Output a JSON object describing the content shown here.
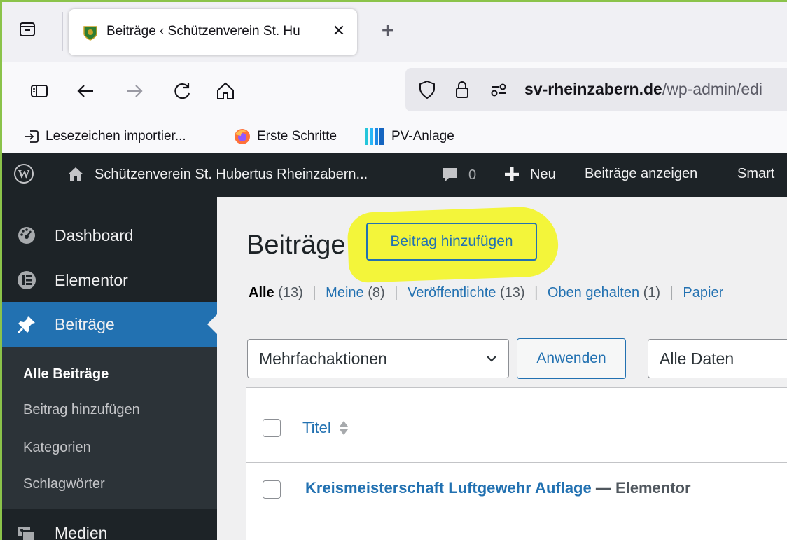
{
  "browser": {
    "tab": {
      "title": "Beiträge ‹ Schützenverein St. Hu",
      "close": "✕"
    },
    "new_tab": "+",
    "url": {
      "domain": "sv-rheinzabern.de",
      "path": "/wp-admin/edi"
    },
    "bookmarks": [
      {
        "label": "Lesezeichen importier..."
      },
      {
        "label": "Erste Schritte"
      },
      {
        "label": "PV-Anlage"
      }
    ]
  },
  "adminbar": {
    "site_name": "Schützenverein St. Hubertus Rheinzabern...",
    "comments_count": "0",
    "new_label": "Neu",
    "view_posts": "Beiträge anzeigen",
    "smart": "Smart"
  },
  "sidebar": {
    "items": [
      {
        "label": "Dashboard"
      },
      {
        "label": "Elementor"
      },
      {
        "label": "Beiträge"
      },
      {
        "label": "Medien"
      }
    ],
    "submenu": [
      {
        "label": "Alle Beiträge"
      },
      {
        "label": "Beitrag hinzufügen"
      },
      {
        "label": "Kategorien"
      },
      {
        "label": "Schlagwörter"
      }
    ]
  },
  "main": {
    "page_title": "Beiträge",
    "add_new": "Beitrag hinzufügen",
    "filters": {
      "all": "Alle",
      "all_count": "(13)",
      "mine": "Meine",
      "mine_count": "(8)",
      "published": "Veröffentlichte",
      "published_count": "(13)",
      "sticky": "Oben gehalten",
      "sticky_count": "(1)",
      "trash": "Papier",
      "separator": "|"
    },
    "bulk_actions": "Mehrfachaktionen",
    "apply": "Anwenden",
    "all_dates": "Alle Daten",
    "table": {
      "col_title": "Titel",
      "rows": [
        {
          "title": "Kreismeisterschaft Luftgewehr Auflage",
          "state": " — Elementor"
        }
      ]
    }
  },
  "colors": {
    "accent": "#2271b1",
    "adminbar_bg": "#1d2327",
    "highlight": "#f3f53a"
  }
}
